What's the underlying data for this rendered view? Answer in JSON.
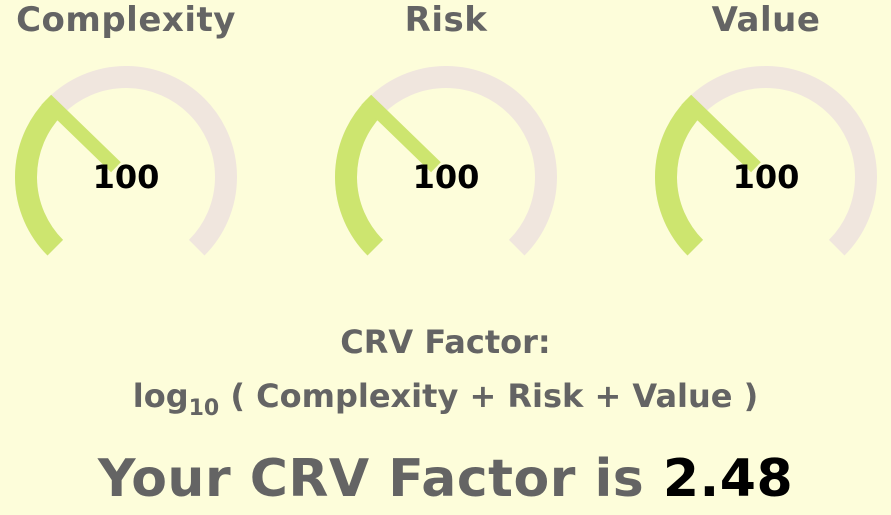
{
  "gauges": [
    {
      "title": "Complexity",
      "value": "100",
      "level": 0.33
    },
    {
      "title": "Risk",
      "value": "100",
      "level": 0.33
    },
    {
      "title": "Value",
      "value": "100",
      "level": 0.33
    }
  ],
  "formula": {
    "heading": "CRV Factor:",
    "log_base_label": "log",
    "log_base_sub": "10",
    "expression": " ( Complexity + Risk + Value )"
  },
  "result": {
    "prefix": "Your CRV Factor is ",
    "value": "2.48"
  },
  "colors": {
    "background": "#fdfdda",
    "gauge_fill": "#cde56f",
    "gauge_track": "#f0e6de",
    "label_text": "#646464",
    "value_text": "#000000"
  }
}
